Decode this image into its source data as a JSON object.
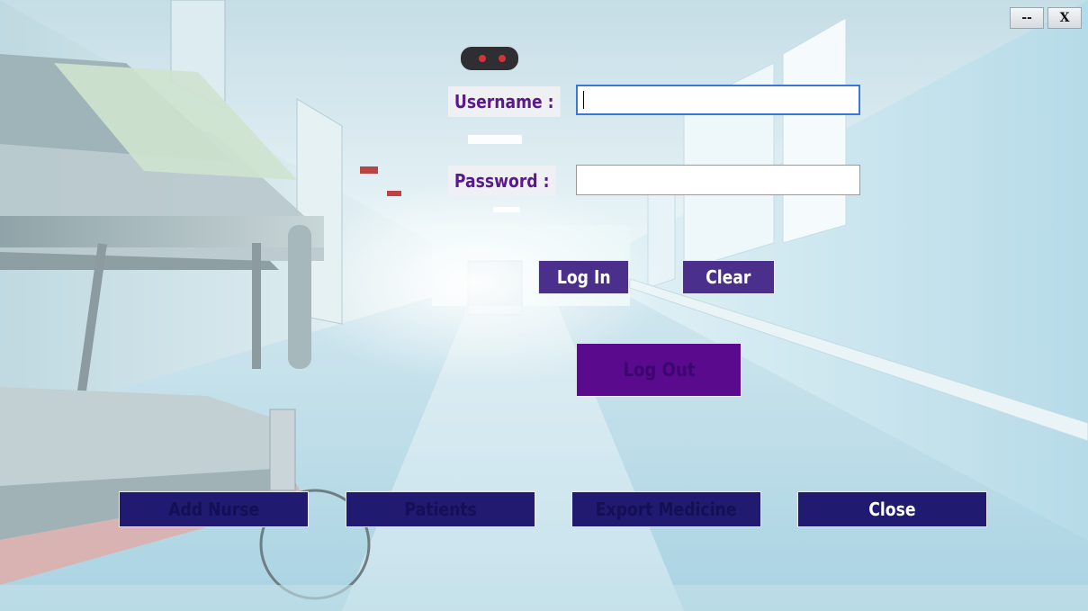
{
  "window_controls": {
    "minimize_label": "--",
    "close_label": "X"
  },
  "login_form": {
    "username_label": "Username :",
    "username_value": "",
    "password_label": "Password :",
    "password_value": ""
  },
  "buttons": {
    "login_label": "Log In",
    "clear_label": "Clear",
    "logout_label": "Log Out"
  },
  "bottom_menu": {
    "add_nurse_label": "Add Nurse",
    "patients_label": "Patients",
    "export_medicine_label": "Export Medicine",
    "close_label": "Close"
  },
  "colors": {
    "label_text": "#5b1a8c",
    "primary_button": "#4b2f8d",
    "logout_button": "#5a0a8c",
    "bottom_button": "#201a70",
    "focus_border": "#3b78d6"
  }
}
